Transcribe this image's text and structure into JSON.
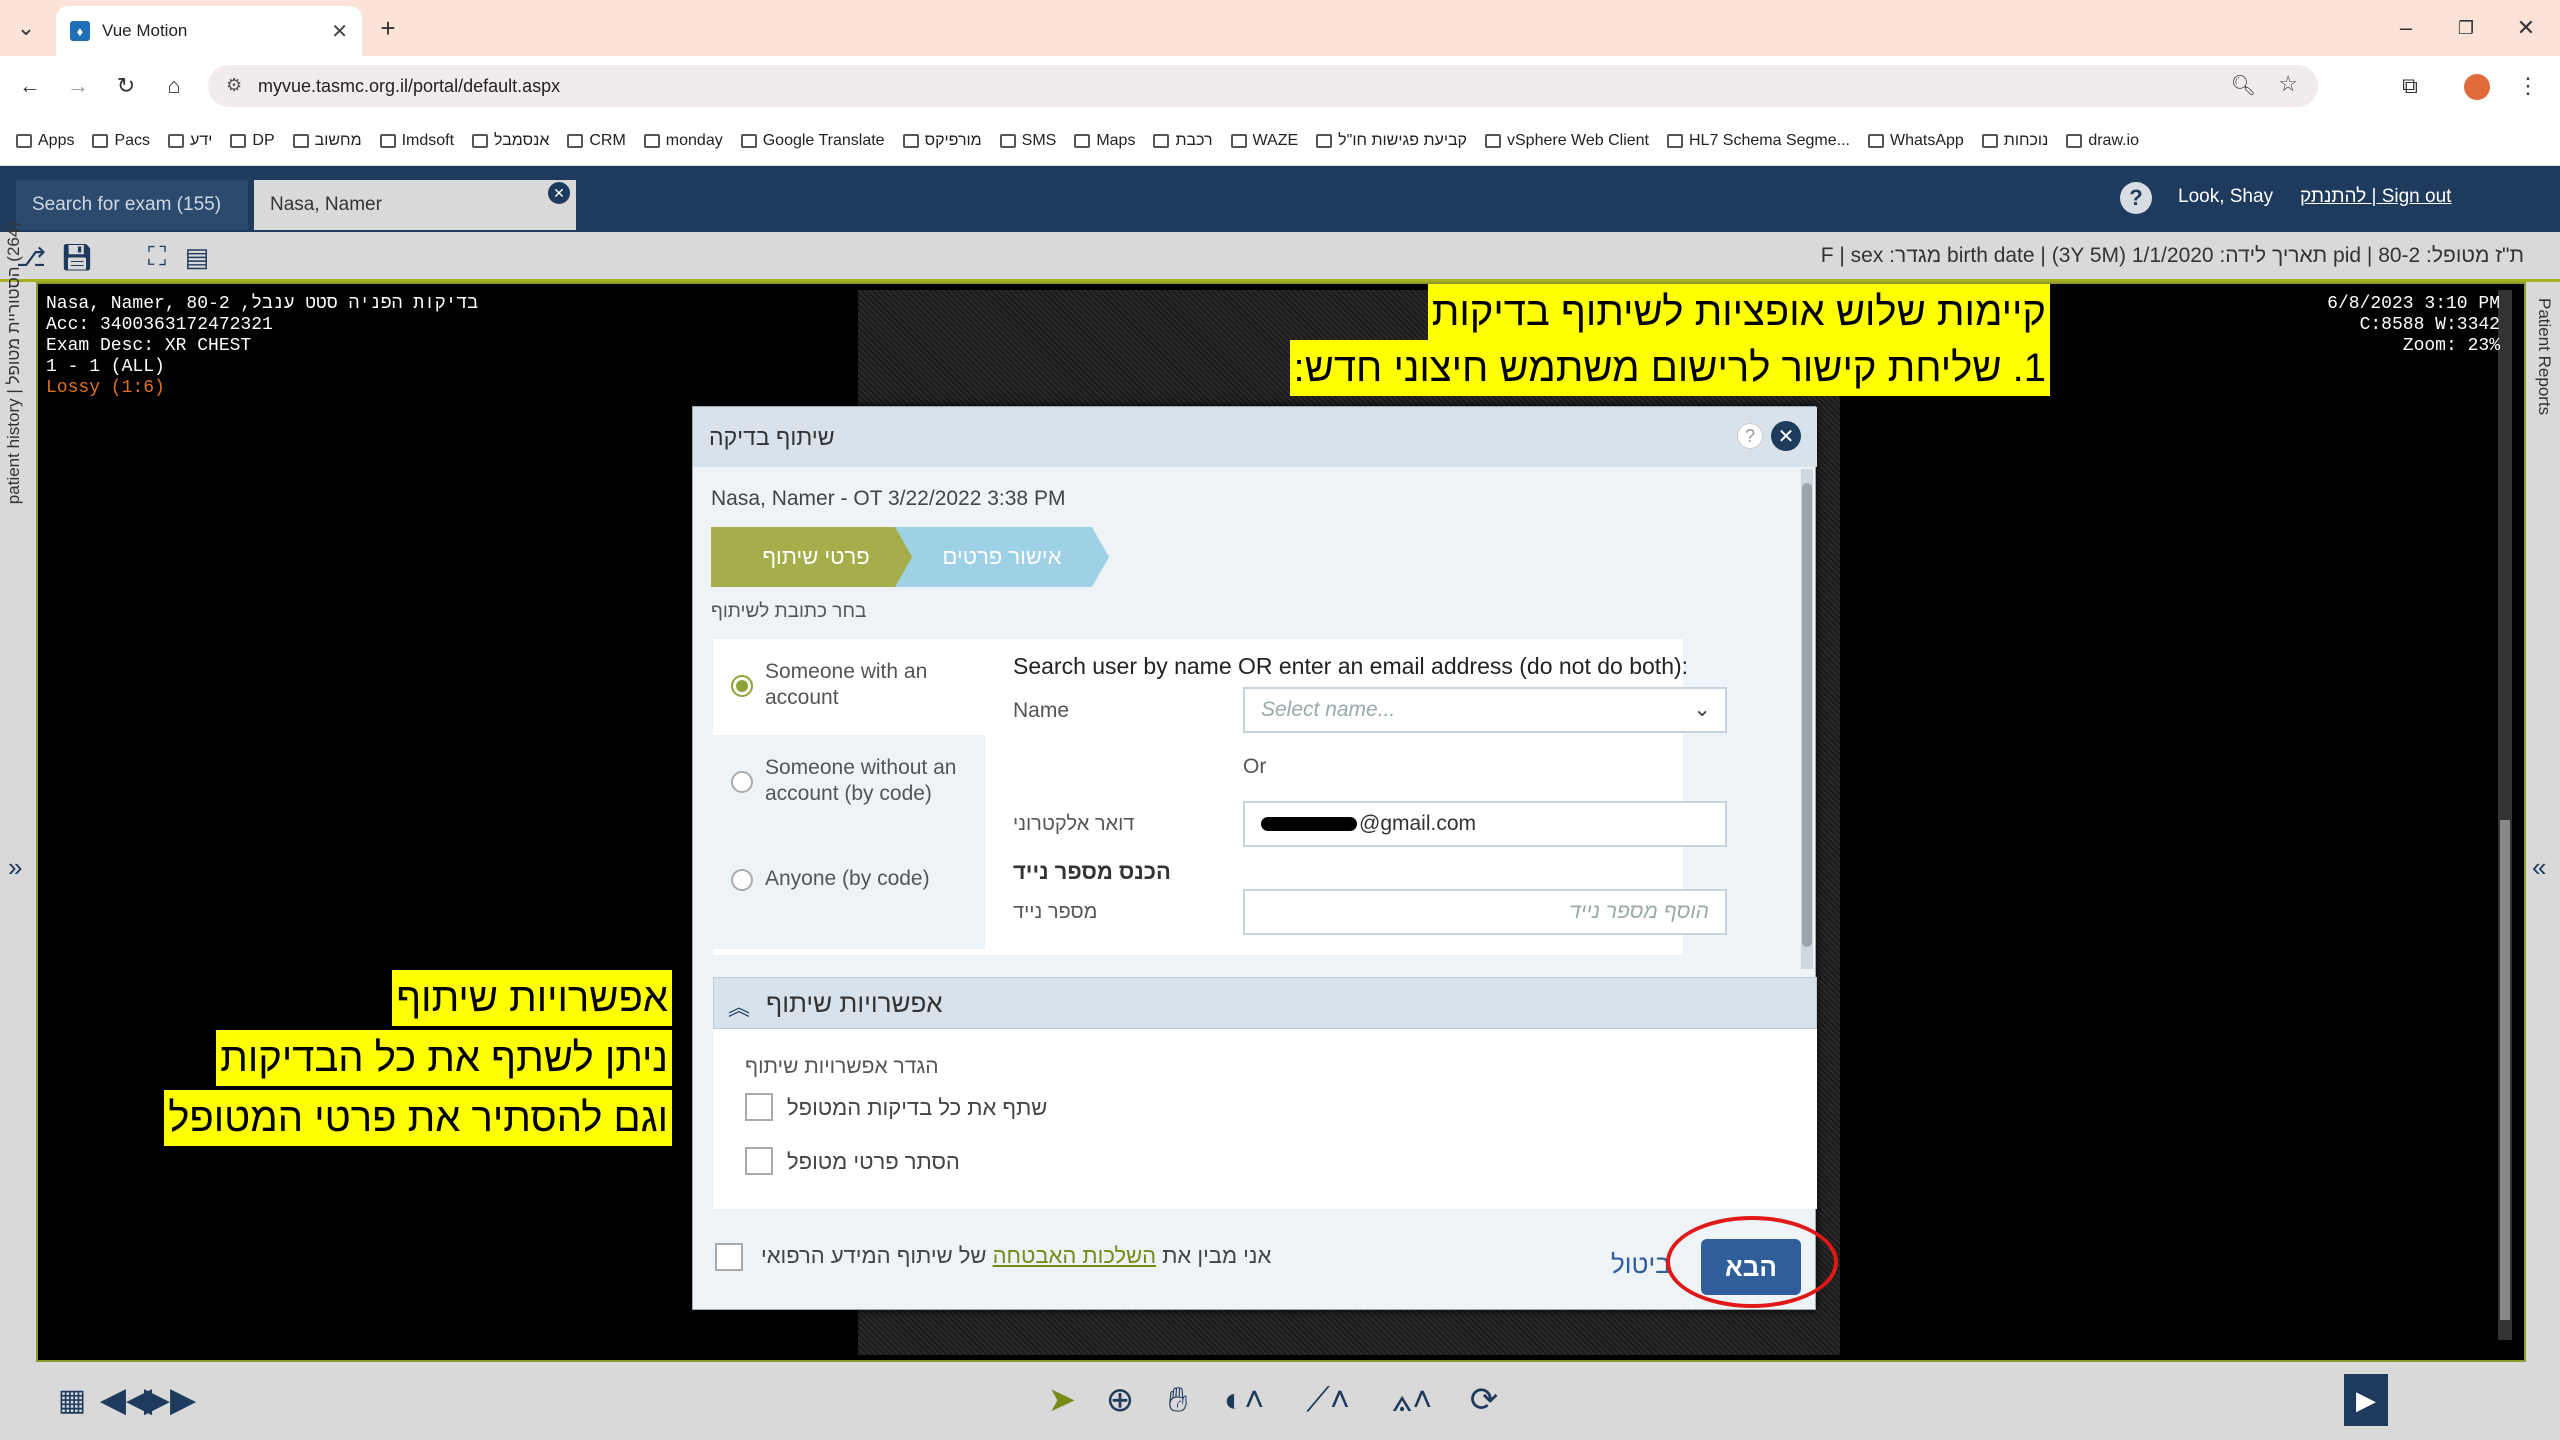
{
  "browser": {
    "tab_title": "Vue Motion",
    "url": "myvue.tasmc.org.il/portal/default.aspx",
    "bookmarks": [
      "Apps",
      "Pacs",
      "ידע",
      "DP",
      "מחשוב",
      "Imdsoft",
      "אנסמבל",
      "CRM",
      "monday",
      "Google Translate",
      "מורפיקס",
      "SMS",
      "Maps",
      "רכבת",
      "WAZE",
      "קביעת פגישות חו\"ל",
      "vSphere Web Client",
      "HL7 Schema Segme...",
      "WhatsApp",
      "נוכחות",
      "draw.io"
    ]
  },
  "app": {
    "tab_search": "Search for exam (155)",
    "tab_patient": "Nasa, Namer",
    "user": "Look, Shay",
    "signout": "להתנתק | Sign out",
    "patient_info": "ת\"ז מטופל: 80-2 | pid    תאריך לידה: 1/1/2020 (3Y 5M) | birth date    מגדר: F | sex",
    "left_strip_label": "(264) הסטוריית מטופל | patient history",
    "right_strip_label": "Patient Reports"
  },
  "viewer": {
    "overlay_left": [
      "Nasa, Namer, 80-2 ,בדיקות הפניה סטט ענבל",
      "Acc: 3400363172472321",
      "Exam Desc: XR CHEST",
      "1 - 1 (ALL)"
    ],
    "overlay_lossy": "Lossy (1:6)",
    "overlay_right": [
      "6/8/2023 3:10 PM",
      "C:8588 W:3342",
      "Zoom: 23%"
    ]
  },
  "annotations": {
    "top_line1": "קיימות שלוש אופציות לשיתוף בדיקות",
    "top_line2": "1. שליחת קישור לרישום משתמש חיצוני חדש:",
    "left_line1": "אפשרויות שיתוף",
    "left_line2": "ניתן לשתף את כל הבדיקות",
    "left_line3": "וגם להסתיר את פרטי המטופל"
  },
  "dialog": {
    "title": "שיתוף בדיקה",
    "subtitle": "Nasa, Namer - OT 3/22/2022 3:38 PM",
    "step1": "פרטי שיתוף",
    "step2": "אישור פרטים",
    "choose_label": "בחר כתובת לשיתוף",
    "options": [
      "Someone with an account",
      "Someone without an account (by code)",
      "Anyone (by code)"
    ],
    "search_hint": "Search user by name OR enter an email address (do not do both):",
    "name_label": "Name",
    "name_placeholder": "Select name...",
    "or": "Or",
    "email_label": "דואר אלקטרוני",
    "email_value": "@gmail.com",
    "phone_header": "הכנס מספר נייד",
    "phone_label": "מספר נייד",
    "phone_placeholder": "הוסף מספר נייד",
    "options_header": "אפשרויות שיתוף",
    "options_sub": "הגדר אפשרויות שיתוף",
    "share_all": "שתף את כל בדיקות המטופל",
    "hide_details": "הסתר פרטי מטופל",
    "agree_pre": "אני מבין את",
    "agree_link": "השלכות האבטחה",
    "agree_post": "של שיתוף המידע הרפואי",
    "cancel": "ביטול",
    "next": "הבא"
  }
}
